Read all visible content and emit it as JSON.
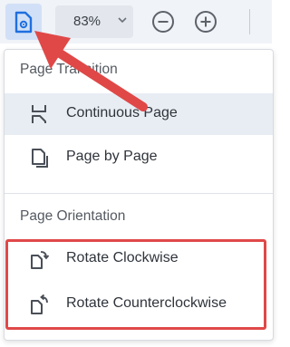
{
  "toolbar": {
    "page_view_icon": "page-settings-icon",
    "zoom_value": "83%",
    "zoom_dropdown_icon": "chevron-down-icon",
    "zoom_out_icon": "minus-circle-icon",
    "zoom_in_icon": "plus-circle-icon"
  },
  "menu": {
    "transition_header": "Page Transition",
    "orientation_header": "Page Orientation",
    "items": [
      {
        "label": "Continuous Page",
        "icon": "continuous-page-icon",
        "selected": true
      },
      {
        "label": "Page by Page",
        "icon": "single-page-icon",
        "selected": false
      },
      {
        "label": "Rotate Clockwise",
        "icon": "rotate-clockwise-icon",
        "selected": false
      },
      {
        "label": "Rotate Counterclockwise",
        "icon": "rotate-counterclockwise-icon",
        "selected": false
      }
    ]
  },
  "colors": {
    "accent": "#1f6fe0",
    "toolbar_bg": "#f0f3f7",
    "selected_item_bg": "#e8edf4",
    "annotation_red": "#e04848"
  }
}
